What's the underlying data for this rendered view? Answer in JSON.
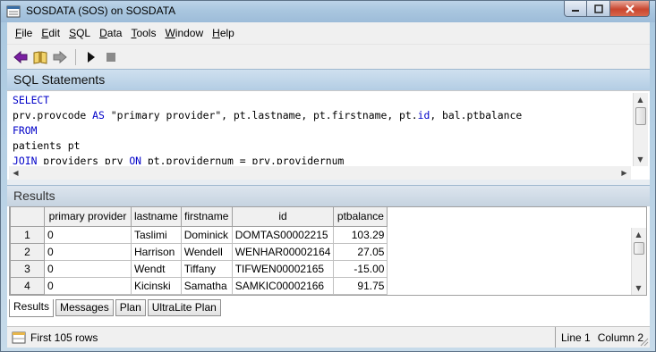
{
  "window": {
    "title": "SOSDATA (SOS) on SOSDATA"
  },
  "menu": [
    {
      "label": "File",
      "key": "F",
      "rest": "ile"
    },
    {
      "label": "Edit",
      "key": "E",
      "rest": "dit"
    },
    {
      "label": "SQL",
      "key": "S",
      "rest": "QL"
    },
    {
      "label": "Data",
      "key": "D",
      "rest": "ata"
    },
    {
      "label": "Tools",
      "key": "T",
      "rest": "ools"
    },
    {
      "label": "Window",
      "key": "W",
      "rest": "indow"
    },
    {
      "label": "Help",
      "key": "H",
      "rest": "elp"
    }
  ],
  "toolbar": {
    "icons": [
      "back-arrow-icon",
      "history-book-icon",
      "forward-arrow-icon",
      "execute-play-icon",
      "stop-icon"
    ]
  },
  "sql_panel": {
    "title": "SQL Statements",
    "lines": [
      [
        {
          "t": "SELECT",
          "kw": true
        }
      ],
      [
        {
          "t": "prv.provcode ",
          "kw": false
        },
        {
          "t": "AS",
          "kw": true
        },
        {
          "t": " \"primary provider\", pt.lastname, pt.firstname, pt.",
          "kw": false
        },
        {
          "t": "id",
          "kw": true
        },
        {
          "t": ", bal.ptbalance",
          "kw": false
        }
      ],
      [
        {
          "t": "FROM",
          "kw": true
        }
      ],
      [
        {
          "t": "patients pt",
          "kw": false
        }
      ],
      [
        {
          "t": "JOIN",
          "kw": true
        },
        {
          "t": " providers prv ",
          "kw": false
        },
        {
          "t": "ON",
          "kw": true
        },
        {
          "t": " pt.providernum = prv.providernum",
          "kw": false
        }
      ]
    ]
  },
  "results_panel": {
    "title": "Results",
    "columns": [
      "primary provider",
      "lastname",
      "firstname",
      "id",
      "ptbalance"
    ],
    "rows": [
      {
        "n": "1",
        "cells": [
          "0",
          "Taslimi",
          "Dominick",
          "DOMTAS00002215",
          "103.29"
        ]
      },
      {
        "n": "2",
        "cells": [
          "0",
          "Harrison",
          "Wendell",
          "WENHAR00002164",
          "27.05"
        ]
      },
      {
        "n": "3",
        "cells": [
          "0",
          "Wendt",
          "Tiffany",
          "TIFWEN00002165",
          "-15.00"
        ]
      },
      {
        "n": "4",
        "cells": [
          "0",
          "Kicinski",
          "Samatha",
          "SAMKIC00002166",
          "91.75"
        ]
      }
    ]
  },
  "tabs": [
    {
      "label": "Results",
      "active": true
    },
    {
      "label": "Messages",
      "active": false
    },
    {
      "label": "Plan",
      "active": false
    },
    {
      "label": "UltraLite Plan",
      "active": false
    }
  ],
  "status": {
    "message": "First 105 rows",
    "line": "Line 1",
    "column": "Column 2"
  },
  "colors": {
    "keyword": "#0000c8",
    "title_bar": "#a9c6df",
    "panel_header": "#b3cde4",
    "close_button": "#c9462f"
  }
}
